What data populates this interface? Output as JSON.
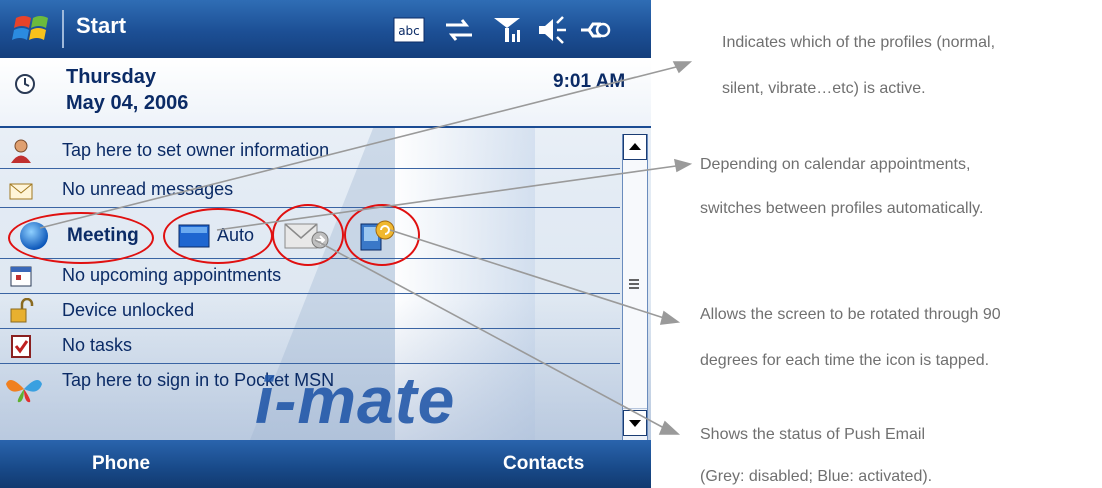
{
  "titlebar": {
    "title": "Start",
    "tray_icons": [
      "abc-input-icon",
      "sync-icon",
      "signal-icon",
      "speaker-icon",
      "connectivity-icon"
    ]
  },
  "today": {
    "day": "Thursday",
    "date": "May 04, 2006",
    "time": "9:01 AM"
  },
  "rows": {
    "owner": "Tap here to set owner information",
    "messages": "No unread messages",
    "appointments": "No upcoming appointments",
    "device": "Device unlocked",
    "tasks": "No tasks",
    "msn": "Tap here to sign in to Pocket MSN"
  },
  "profile_row": {
    "profile": "Meeting",
    "auto": "Auto"
  },
  "logo": {
    "text": "i-mate"
  },
  "softkeys": {
    "left": "Phone",
    "right": "Contacts"
  },
  "notes": {
    "profile_1": "Indicates which of the profiles (normal,",
    "profile_2": "silent, vibrate…etc) is active.",
    "auto_1": "Depending on calendar appointments,",
    "auto_2": "switches between profiles automatically.",
    "rotate_1": "Allows the screen to be rotated through 90",
    "rotate_2": "degrees for each time the icon is tapped.",
    "email_1": "Shows the status of Push Email",
    "email_2": "(Grey: disabled; Blue: activated)."
  },
  "colors": {
    "accent": "#1c4f95",
    "callout": "#e01010",
    "note_text": "#707070"
  }
}
